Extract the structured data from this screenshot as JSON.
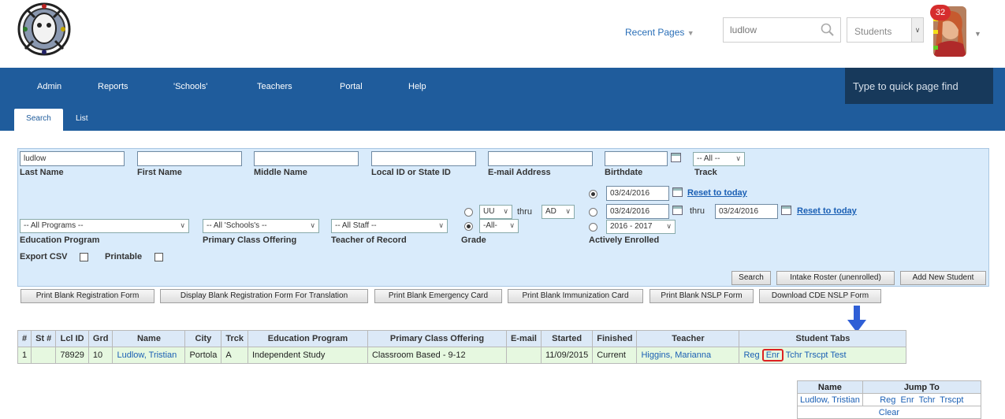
{
  "header": {
    "recent_pages": "Recent Pages",
    "search_value": "ludlow",
    "scope_value": "Students",
    "notification_count": "32"
  },
  "nav": {
    "items": [
      "Admin",
      "Reports",
      "'Schools'",
      "Teachers",
      "Portal",
      "Help"
    ],
    "quick_find_placeholder": "Type to quick page find",
    "tabs": [
      "Search",
      "List"
    ]
  },
  "filters": {
    "last_name": {
      "label": "Last Name",
      "value": "ludlow"
    },
    "first_name": {
      "label": "First Name",
      "value": ""
    },
    "middle_name": {
      "label": "Middle Name",
      "value": ""
    },
    "local_id": {
      "label": "Local ID or State ID",
      "value": ""
    },
    "email": {
      "label": "E-mail Address",
      "value": ""
    },
    "birthdate": {
      "label": "Birthdate",
      "value": ""
    },
    "track": {
      "label": "Track",
      "value": "-- All --"
    },
    "program": {
      "label": "Education Program",
      "value": "-- All Programs --"
    },
    "class_offering": {
      "label": "Primary Class Offering",
      "value": "-- All 'Schools's --"
    },
    "teacher": {
      "label": "Teacher of Record",
      "value": "-- All Staff --"
    },
    "grade": {
      "label": "Grade",
      "from": "UU",
      "thru_label": "thru",
      "to": "AD",
      "all": "-All-"
    },
    "enrolled": {
      "label": "Actively Enrolled",
      "date1": "03/24/2016",
      "date2_from": "03/24/2016",
      "thru_label": "thru",
      "date2_to": "03/24/2016",
      "year": "2016 - 2017",
      "reset": "Reset to today"
    },
    "export_csv": "Export CSV",
    "printable": "Printable"
  },
  "actions": {
    "search": "Search",
    "intake": "Intake Roster (unenrolled)",
    "add_new": "Add New Student"
  },
  "print_buttons": [
    "Print Blank Registration Form",
    "Display Blank Registration Form For Translation",
    "Print Blank Emergency Card",
    "Print Blank Immunization Card",
    "Print Blank NSLP Form",
    "Download CDE NSLP Form"
  ],
  "results": {
    "headers": [
      "#",
      "St #",
      "Lcl ID",
      "Grd",
      "Name",
      "City",
      "Trck",
      "Education Program",
      "Primary Class Offering",
      "E-mail",
      "Started",
      "Finished",
      "Teacher",
      "Student Tabs"
    ],
    "row": {
      "num": "1",
      "st": "",
      "lcl_id": "78929",
      "grade": "10",
      "name": "Ludlow, Tristian",
      "city": "Portola",
      "track": "A",
      "program": "Independent Study",
      "offering": "Classroom Based - 9-12",
      "email": "",
      "started": "11/09/2015",
      "finished": "Current",
      "teacher": "Higgins, Marianna",
      "tabs": [
        "Reg",
        "Enr",
        "Tchr",
        "Trscpt",
        "Test"
      ]
    }
  },
  "jump": {
    "headers": [
      "Name",
      "Jump To"
    ],
    "name": "Ludlow, Tristian",
    "links": [
      "Reg",
      "Enr",
      "Tchr",
      "Trscpt"
    ],
    "clear": "Clear"
  },
  "colors": {
    "nav": "#1f5c9c",
    "quick_find": "#17395b",
    "panel": "#d9ebfb",
    "row": "#e6f8e0",
    "arrow": "#2f5fd6",
    "highlight": "#d22222"
  }
}
